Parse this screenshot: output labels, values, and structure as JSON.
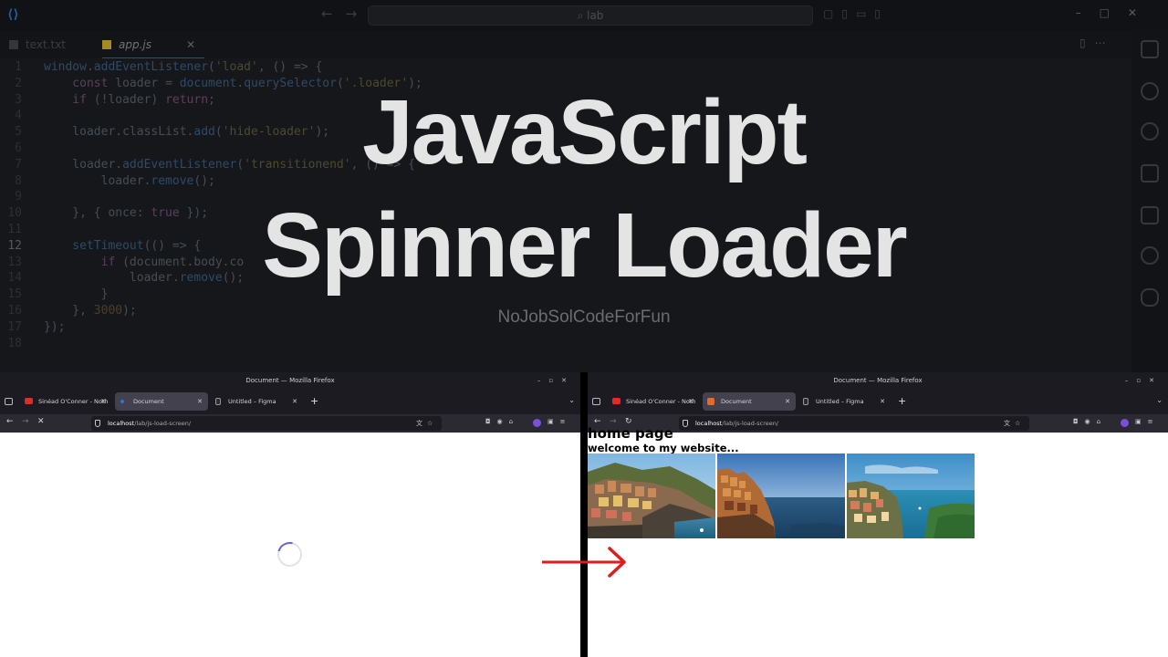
{
  "vscode": {
    "search": "lab",
    "tabs": [
      {
        "label": "text.txt"
      },
      {
        "label": "app.js",
        "active": true
      }
    ],
    "code_lines": [
      {
        "n": "1",
        "segs": [
          [
            "fn",
            "window"
          ],
          [
            "vr",
            "."
          ],
          [
            "fn",
            "addEventListener"
          ],
          [
            "vr",
            "("
          ],
          [
            "str",
            "'load'"
          ],
          [
            "vr",
            ", () => {"
          ]
        ]
      },
      {
        "n": "2",
        "segs": [
          [
            "kw",
            "    const "
          ],
          [
            "vr",
            "loader = "
          ],
          [
            "fn",
            "document"
          ],
          [
            "vr",
            "."
          ],
          [
            "fn",
            "querySelector"
          ],
          [
            "vr",
            "("
          ],
          [
            "str",
            "'.loader'"
          ],
          [
            "vr",
            ");"
          ]
        ]
      },
      {
        "n": "3",
        "segs": [
          [
            "kw",
            "    if "
          ],
          [
            "vr",
            "(!loader) "
          ],
          [
            "kw",
            "return"
          ],
          [
            "vr",
            ";"
          ]
        ]
      },
      {
        "n": "4",
        "segs": [
          [
            "vr",
            ""
          ]
        ]
      },
      {
        "n": "5",
        "segs": [
          [
            "vr",
            "    loader.classList."
          ],
          [
            "fn",
            "add"
          ],
          [
            "vr",
            "("
          ],
          [
            "str",
            "'hide-loader'"
          ],
          [
            "vr",
            ");"
          ]
        ]
      },
      {
        "n": "6",
        "segs": [
          [
            "vr",
            ""
          ]
        ]
      },
      {
        "n": "7",
        "segs": [
          [
            "vr",
            "    loader."
          ],
          [
            "fn",
            "addEventListener"
          ],
          [
            "vr",
            "("
          ],
          [
            "str",
            "'transitionend'"
          ],
          [
            "vr",
            ", () => {"
          ]
        ]
      },
      {
        "n": "8",
        "segs": [
          [
            "vr",
            "        loader."
          ],
          [
            "fn",
            "remove"
          ],
          [
            "vr",
            "();"
          ]
        ]
      },
      {
        "n": "9",
        "segs": [
          [
            "vr",
            ""
          ]
        ]
      },
      {
        "n": "10",
        "segs": [
          [
            "vr",
            "    }, { once: "
          ],
          [
            "kw",
            "true"
          ],
          [
            "vr",
            " });"
          ]
        ]
      },
      {
        "n": "11",
        "segs": [
          [
            "vr",
            ""
          ]
        ]
      },
      {
        "n": "12",
        "segs": [
          [
            "fn",
            "    setTimeout"
          ],
          [
            "vr",
            "(() => {"
          ]
        ]
      },
      {
        "n": "13",
        "segs": [
          [
            "kw",
            "        if "
          ],
          [
            "vr",
            "(document.body.co"
          ]
        ]
      },
      {
        "n": "14",
        "segs": [
          [
            "vr",
            "            loader."
          ],
          [
            "fn",
            "remove"
          ],
          [
            "vr",
            "();"
          ]
        ]
      },
      {
        "n": "15",
        "segs": [
          [
            "vr",
            "        }"
          ]
        ]
      },
      {
        "n": "16",
        "segs": [
          [
            "vr",
            "    }, "
          ],
          [
            "num",
            "3000"
          ],
          [
            "vr",
            ");"
          ]
        ]
      },
      {
        "n": "17",
        "segs": [
          [
            "vr",
            "});"
          ]
        ]
      },
      {
        "n": "18",
        "segs": [
          [
            "vr",
            ""
          ]
        ]
      }
    ],
    "current_line": "12"
  },
  "overlay": {
    "title_line1": "JavaScript",
    "title_line2": "Spinner Loader",
    "subtitle": "NoJobSolCodeForFun"
  },
  "browser_left": {
    "window_title": "Document — Mozilla Firefox",
    "tabs": [
      {
        "label": "Sinéad O'Conner - Noth"
      },
      {
        "label": "Document",
        "active": true
      },
      {
        "label": "Untitled – Figma"
      }
    ],
    "url_host": "localhost",
    "url_path": "/lab/js-load-screen/",
    "state": "loading"
  },
  "browser_right": {
    "window_title": "Document — Mozilla Firefox",
    "tabs": [
      {
        "label": "Sinéad O'Conner - Noth"
      },
      {
        "label": "Document",
        "active": true
      },
      {
        "label": "Untitled – Figma"
      }
    ],
    "url_host": "localhost",
    "url_path": "/lab/js-load-screen/",
    "page": {
      "heading": "home page",
      "subheading": "welcome to my website..."
    },
    "photos": [
      "cinque-terre-village-photo",
      "cliff-town-sunset-photo",
      "coastal-town-sea-photo"
    ]
  },
  "colors": {
    "spinner_accent": "#6262e0",
    "arrow": "#e01b1b",
    "title_text": "#e4e4e4"
  }
}
